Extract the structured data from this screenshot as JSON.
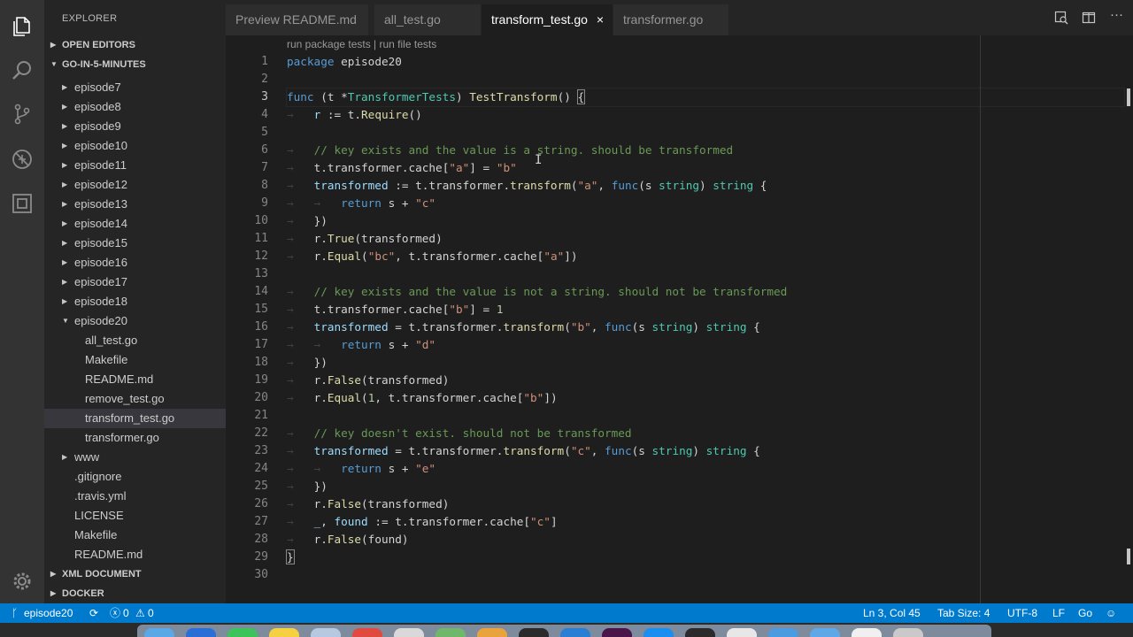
{
  "activity_bar": {
    "icons": [
      "explorer-icon",
      "search-icon",
      "source-control-icon",
      "debug-icon",
      "extensions-icon",
      "settings-gear-icon"
    ]
  },
  "sidebar": {
    "title": "EXPLORER",
    "open_editors": "OPEN EDITORS",
    "project": "GO-IN-5-MINUTES",
    "xml_document": "XML DOCUMENT",
    "docker": "DOCKER",
    "tree": [
      {
        "label": "episode7",
        "level": 1,
        "folder": true,
        "expanded": false
      },
      {
        "label": "episode8",
        "level": 1,
        "folder": true,
        "expanded": false
      },
      {
        "label": "episode9",
        "level": 1,
        "folder": true,
        "expanded": false
      },
      {
        "label": "episode10",
        "level": 1,
        "folder": true,
        "expanded": false
      },
      {
        "label": "episode11",
        "level": 1,
        "folder": true,
        "expanded": false
      },
      {
        "label": "episode12",
        "level": 1,
        "folder": true,
        "expanded": false
      },
      {
        "label": "episode13",
        "level": 1,
        "folder": true,
        "expanded": false
      },
      {
        "label": "episode14",
        "level": 1,
        "folder": true,
        "expanded": false
      },
      {
        "label": "episode15",
        "level": 1,
        "folder": true,
        "expanded": false
      },
      {
        "label": "episode16",
        "level": 1,
        "folder": true,
        "expanded": false
      },
      {
        "label": "episode17",
        "level": 1,
        "folder": true,
        "expanded": false
      },
      {
        "label": "episode18",
        "level": 1,
        "folder": true,
        "expanded": false
      },
      {
        "label": "episode20",
        "level": 1,
        "folder": true,
        "expanded": true
      },
      {
        "label": "all_test.go",
        "level": 2,
        "folder": false
      },
      {
        "label": "Makefile",
        "level": 2,
        "folder": false
      },
      {
        "label": "README.md",
        "level": 2,
        "folder": false
      },
      {
        "label": "remove_test.go",
        "level": 2,
        "folder": false
      },
      {
        "label": "transform_test.go",
        "level": 2,
        "folder": false,
        "selected": true
      },
      {
        "label": "transformer.go",
        "level": 2,
        "folder": false
      },
      {
        "label": "www",
        "level": 1,
        "folder": true,
        "expanded": false
      },
      {
        "label": ".gitignore",
        "level": 1,
        "folder": false
      },
      {
        "label": ".travis.yml",
        "level": 1,
        "folder": false
      },
      {
        "label": "LICENSE",
        "level": 1,
        "folder": false
      },
      {
        "label": "Makefile",
        "level": 1,
        "folder": false
      },
      {
        "label": "README.md",
        "level": 1,
        "folder": false
      }
    ]
  },
  "tabs": [
    {
      "label": "Preview README.md",
      "active": false
    },
    {
      "label": "all_test.go",
      "active": false
    },
    {
      "label": "transform_test.go",
      "active": true
    },
    {
      "label": "transformer.go",
      "active": false
    }
  ],
  "tab_close": "×",
  "editor": {
    "codelens": "run package tests | run file tests",
    "current_line": 3,
    "lines": [
      {
        "n": "1",
        "html": "<span class=\"kw\">package</span> episode20"
      },
      {
        "n": "2",
        "html": ""
      },
      {
        "n": "3",
        "html": "<span class=\"kw\">func</span> (t *<span class=\"ty\">TransformerTests</span>) <span class=\"fn\">TestTransform</span>() <span class=\"brk\">{</span>"
      },
      {
        "n": "4",
        "html": "<span class=\"arrow\">→   </span><span class=\"var\">r</span> := t.<span class=\"fn\">Require</span>()"
      },
      {
        "n": "5",
        "html": ""
      },
      {
        "n": "6",
        "html": "<span class=\"arrow\">→   </span><span class=\"cmt\">// key exists and the value is a string. should be transformed</span>"
      },
      {
        "n": "7",
        "html": "<span class=\"arrow\">→   </span>t.transformer.cache[<span class=\"str\">\"a\"</span>] = <span class=\"str\">\"b\"</span>"
      },
      {
        "n": "8",
        "html": "<span class=\"arrow\">→   </span><span class=\"var\">transformed</span> := t.transformer.<span class=\"fn\">transform</span>(<span class=\"str\">\"a\"</span>, <span class=\"kw\">func</span>(s <span class=\"ty\">string</span>) <span class=\"ty\">string</span> {"
      },
      {
        "n": "9",
        "html": "<span class=\"arrow\">→   →   </span><span class=\"kw\">return</span> s + <span class=\"str\">\"c\"</span>"
      },
      {
        "n": "10",
        "html": "<span class=\"arrow\">→   </span>})"
      },
      {
        "n": "11",
        "html": "<span class=\"arrow\">→   </span>r.<span class=\"fn\">True</span>(transformed)"
      },
      {
        "n": "12",
        "html": "<span class=\"arrow\">→   </span>r.<span class=\"fn\">Equal</span>(<span class=\"str\">\"bc\"</span>, t.transformer.cache[<span class=\"str\">\"a\"</span>])"
      },
      {
        "n": "13",
        "html": ""
      },
      {
        "n": "14",
        "html": "<span class=\"arrow\">→   </span><span class=\"cmt\">// key exists and the value is not a string. should not be transformed</span>"
      },
      {
        "n": "15",
        "html": "<span class=\"arrow\">→   </span>t.transformer.cache[<span class=\"str\">\"b\"</span>] = <span class=\"num\">1</span>"
      },
      {
        "n": "16",
        "html": "<span class=\"arrow\">→   </span><span class=\"var\">transformed</span> = t.transformer.<span class=\"fn\">transform</span>(<span class=\"str\">\"b\"</span>, <span class=\"kw\">func</span>(s <span class=\"ty\">string</span>) <span class=\"ty\">string</span> {"
      },
      {
        "n": "17",
        "html": "<span class=\"arrow\">→   →   </span><span class=\"kw\">return</span> s + <span class=\"str\">\"d\"</span>"
      },
      {
        "n": "18",
        "html": "<span class=\"arrow\">→   </span>})"
      },
      {
        "n": "19",
        "html": "<span class=\"arrow\">→   </span>r.<span class=\"fn\">False</span>(transformed)"
      },
      {
        "n": "20",
        "html": "<span class=\"arrow\">→   </span>r.<span class=\"fn\">Equal</span>(<span class=\"num\">1</span>, t.transformer.cache[<span class=\"str\">\"b\"</span>])"
      },
      {
        "n": "21",
        "html": ""
      },
      {
        "n": "22",
        "html": "<span class=\"arrow\">→   </span><span class=\"cmt\">// key doesn't exist. should not be transformed</span>"
      },
      {
        "n": "23",
        "html": "<span class=\"arrow\">→   </span><span class=\"var\">transformed</span> = t.transformer.<span class=\"fn\">transform</span>(<span class=\"str\">\"c\"</span>, <span class=\"kw\">func</span>(s <span class=\"ty\">string</span>) <span class=\"ty\">string</span> {"
      },
      {
        "n": "24",
        "html": "<span class=\"arrow\">→   →   </span><span class=\"kw\">return</span> s + <span class=\"str\">\"e\"</span>"
      },
      {
        "n": "25",
        "html": "<span class=\"arrow\">→   </span>})"
      },
      {
        "n": "26",
        "html": "<span class=\"arrow\">→   </span>r.<span class=\"fn\">False</span>(transformed)"
      },
      {
        "n": "27",
        "html": "<span class=\"arrow\">→   </span><span class=\"var\">_</span>, <span class=\"var\">found</span> := t.transformer.cache[<span class=\"str\">\"c\"</span>]"
      },
      {
        "n": "28",
        "html": "<span class=\"arrow\">→   </span>r.<span class=\"fn\">False</span>(found)"
      },
      {
        "n": "29",
        "html": "<span class=\"brk\">}</span>"
      },
      {
        "n": "30",
        "html": ""
      }
    ]
  },
  "status_bar": {
    "branch": "episode20",
    "errors": "0",
    "warnings": "0",
    "position": "Ln 3, Col 45",
    "tab_size": "Tab Size: 4",
    "encoding": "UTF-8",
    "eol": "LF",
    "language": "Go",
    "colors": {
      "background": "#007acc"
    }
  },
  "dock": {
    "icons": [
      "finder-icon",
      "safari-icon",
      "messages-icon",
      "notes-icon",
      "mail-icon",
      "calendar-icon",
      "reminders-icon",
      "maps-icon",
      "photos-icon",
      "terminal-icon",
      "vscode-icon",
      "slack-icon",
      "app-store-icon",
      "activity-monitor-icon",
      "chrome-icon",
      "folder-icon",
      "downloads-icon",
      "document-icon",
      "trash-icon"
    ]
  }
}
